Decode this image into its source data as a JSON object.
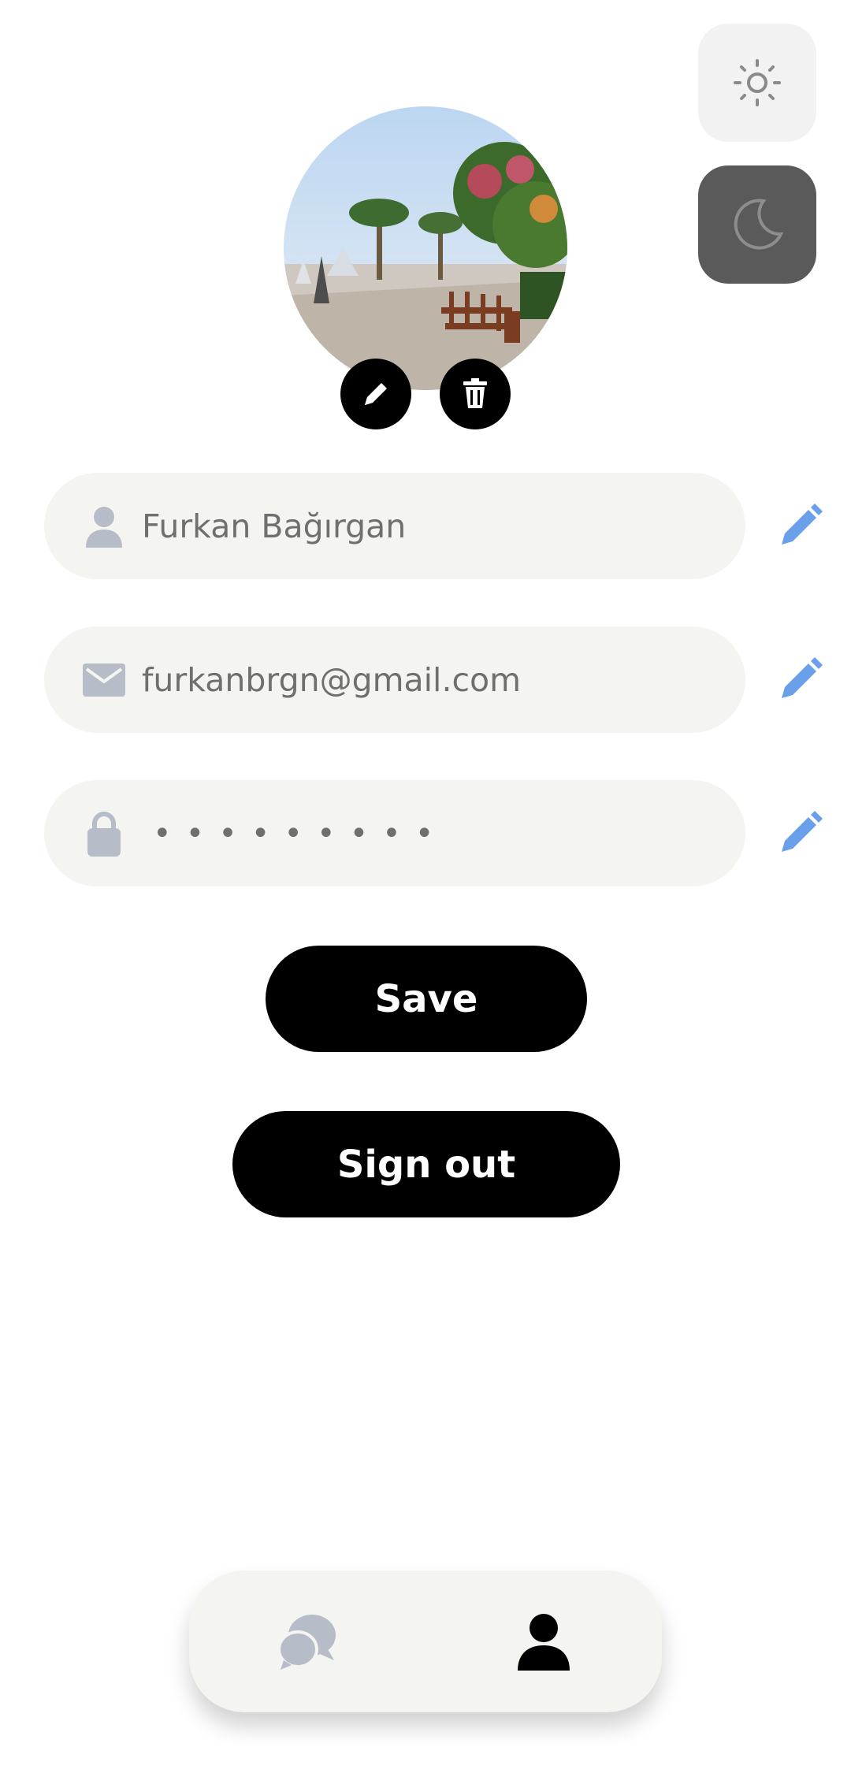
{
  "theme": {
    "light_icon": "sun-icon",
    "dark_icon": "moon-icon"
  },
  "profile": {
    "avatar": "profile-photo",
    "name": "Furkan Bağırgan",
    "email": "furkanbrgn@gmail.com",
    "password_mask": "•••••••••"
  },
  "actions": {
    "save_label": "Save",
    "signout_label": "Sign out"
  },
  "nav": {
    "items": [
      {
        "name": "chats",
        "icon": "chat-bubbles-icon",
        "active": false
      },
      {
        "name": "profile",
        "icon": "user-icon",
        "active": true
      }
    ]
  },
  "colors": {
    "edit_accent": "#6aa0ea",
    "field_bg": "#f4f5f1",
    "icon_gray": "#b6bdc8",
    "button_bg": "#000000"
  }
}
